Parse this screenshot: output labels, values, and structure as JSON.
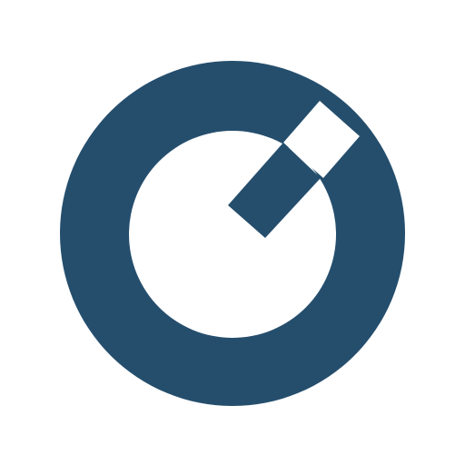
{
  "logo": {
    "icon": "dial-icon",
    "color": "#254e6d",
    "background": "#ffffff"
  }
}
